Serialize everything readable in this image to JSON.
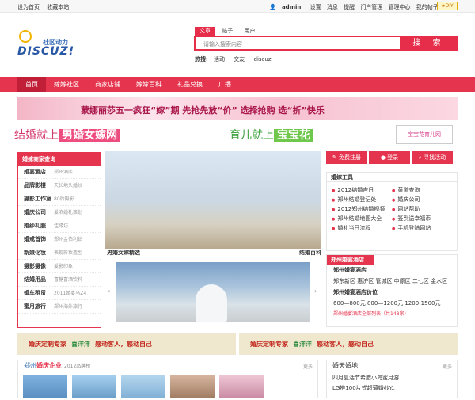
{
  "topbar": {
    "left": [
      "设为首页",
      "收藏本站"
    ],
    "user": "admin",
    "right": [
      "设置",
      "消息",
      "提醒",
      "门户管理",
      "管理中心",
      "我的帖子",
      "退出"
    ],
    "diy": "DIY"
  },
  "logo": {
    "cn": "社区动力",
    "en": "DISCUZ!"
  },
  "search": {
    "tabs": [
      "文章",
      "帖子",
      "用户"
    ],
    "placeholder": "请输入搜索内容",
    "button": "搜 索",
    "hot_label": "热搜:",
    "hot": [
      "活动",
      "交友",
      "discuz"
    ]
  },
  "nav": [
    "首页",
    "嫁嫁社区",
    "商家店铺",
    "嫁嫁百科",
    "礼品兑换",
    "广播"
  ],
  "banner1": "蒙娜丽莎五一疯狂“嫁”期  先抢先放“价”  选择抢购  选“折”快乐",
  "banner2": {
    "pre1": "结婚就上",
    "hl1": "男婚女嫁网",
    "pre2": "育儿就上",
    "hl2": "宝宝花",
    "brand": "宝宝花育儿网"
  },
  "merchant": {
    "title": "婚嫁商家查询",
    "rows": [
      {
        "name": "婚宴酒店",
        "desc": "郑州酒店"
      },
      {
        "name": "品牌影楼",
        "desc": "天长地久婚纱"
      },
      {
        "name": "摄影工作室",
        "desc": "80后摄影"
      },
      {
        "name": "婚庆公司",
        "desc": "爱浓婚礼策划"
      },
      {
        "name": "婚纱礼服",
        "desc": "佳缘坊"
      },
      {
        "name": "婚戒首饰",
        "desc": "郑州金伯利钻"
      },
      {
        "name": "新娘化妆",
        "desc": "表现彩妆造型"
      },
      {
        "name": "摄影摄像",
        "desc": "爱影印象"
      },
      {
        "name": "结婚用品",
        "desc": "喜糖喜酒饮料"
      },
      {
        "name": "婚车租赁",
        "desc": "2011婚宴马Z4"
      },
      {
        "name": "蜜月旅行",
        "desc": "郑州海外旅行"
      }
    ]
  },
  "slide1": {
    "caption": "男婚女嫁精选",
    "right": "结婚百科"
  },
  "arrows": {
    "prev": "‹",
    "next": "›"
  },
  "right_buttons": [
    "免费注册",
    "登录",
    "寻找活动"
  ],
  "tools": {
    "title": "婚嫁工具",
    "items": [
      "2012结婚吉日",
      "黄道查询",
      "郑州结婚登记处",
      "婚庆公司",
      "2012郑州结婚视频",
      "网站帮助",
      "郑州结婚地图大全",
      "签到送幸福币",
      "婚礼当日流程",
      "手机登陆网站"
    ]
  },
  "venue": {
    "title": "郑州婚宴酒店",
    "name": "郑州婚宴酒店",
    "regions": "郑东新区 惠济区 管城区 中原区 二七区 金水区",
    "price_label": "郑州婚宴酒店价位",
    "prices": "600—800元  800—1200元  1200-1500元",
    "link": "郑州婚宴酒店全部列表（共148家）"
  },
  "ad_strip": [
    {
      "a": "婚庆定制专家",
      "b": "喜洋洋",
      "c": "感动客人，感动自己"
    },
    {
      "a": "婚庆定制专家",
      "b": "喜洋洋",
      "c": "感动客人，感动自己"
    }
  ],
  "sec_company": {
    "title_a": "郑州",
    "title_b": "婚庆企业",
    "sub": "2012品牌榜",
    "more": "更多"
  },
  "sec_news": {
    "title": "婚天婚地",
    "more": "更多",
    "lines": [
      "四月复活节希腊小岛蜜月游",
      "LG推100片式超薄婚纱Y.."
    ]
  }
}
